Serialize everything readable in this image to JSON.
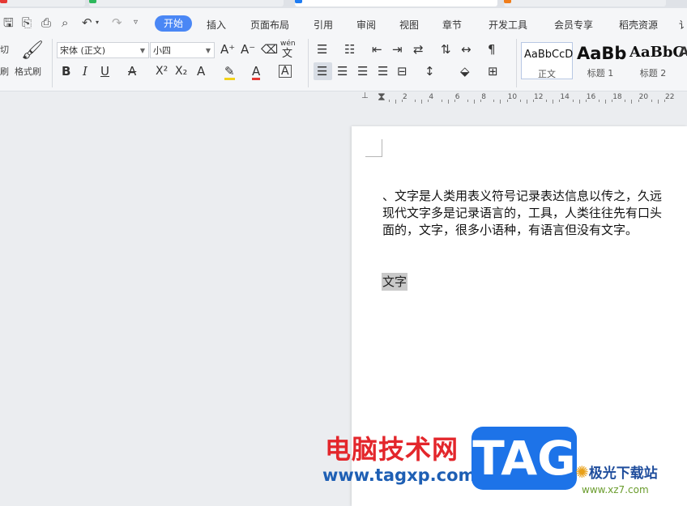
{
  "tabs": {
    "tab1_color": "#e53935",
    "tab2_color": "#2eb85c",
    "tab3_color": "#1f7cf2",
    "tab4_color": "#f07d1a"
  },
  "quick_access": {
    "save_icon": "save-icon",
    "export_icon": "export-icon",
    "print_icon": "print-icon",
    "preview_icon": "print-preview-icon",
    "undo_icon": "undo-icon",
    "redo_icon": "redo-icon",
    "more_icon": "chevron-down-icon"
  },
  "menu": {
    "start": "开始",
    "insert": "插入",
    "page_layout": "页面布局",
    "references": "引用",
    "review": "审阅",
    "view": "视图",
    "section": "章节",
    "developer": "开发工具",
    "member": "会员专享",
    "resources": "稻壳资源",
    "more": "讠"
  },
  "toolbar": {
    "cut_label": "切",
    "brush_label": "刷",
    "format_painter_label": "格式刷",
    "font_name": "宋体 (正文)",
    "font_size": "小四",
    "phonetic": "wén"
  },
  "styles": {
    "normal_sample": "AaBbCcD",
    "normal_caption": "正文",
    "h1_sample": "AaBb",
    "h1_caption": "标题 1",
    "h2_sample": "AaBbC",
    "h2_caption": "标题 2",
    "h3_sample": "A"
  },
  "ruler": {
    "labels": [
      "2",
      "4",
      "6",
      "8",
      "10",
      "12",
      "14",
      "16",
      "18",
      "20",
      "22"
    ]
  },
  "document": {
    "line1": "、文字是人类用表义符号记录表达信息以传之，久远",
    "line2": "现代文字多是记录语言的，工具，人类往往先有口头",
    "line3": "面的，文字，很多小语种，有语言但没有文字。",
    "selected_text": "文字"
  },
  "watermark": {
    "site_name": "电脑技术网",
    "site_url": "www.tagxp.com",
    "tag": "TAG",
    "logo_name": "极光下载站",
    "logo_url": "www.xz7.com"
  }
}
